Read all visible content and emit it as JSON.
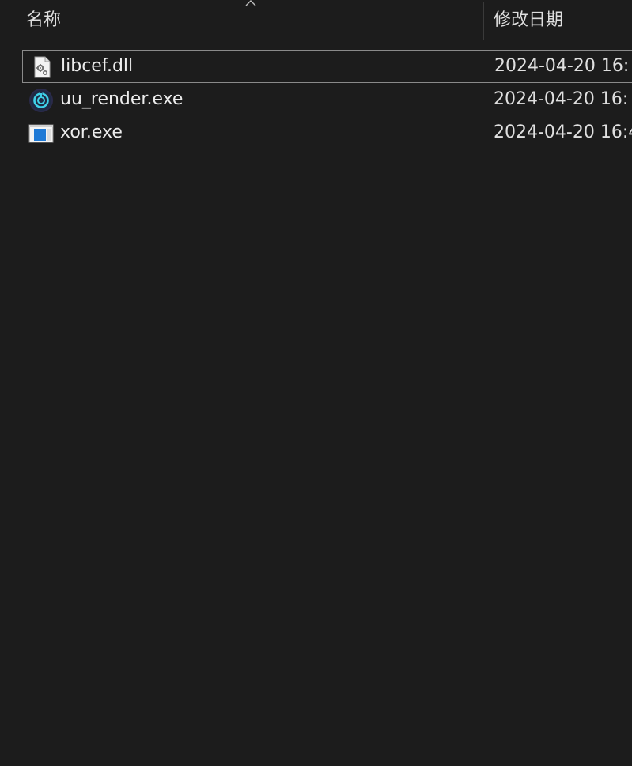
{
  "header": {
    "name_label": "名称",
    "date_label": "修改日期",
    "sort_icon": "chevron-up-icon"
  },
  "files": [
    {
      "name": "libcef.dll",
      "date": "2024-04-20 16:",
      "icon": "dll-settings-file-icon"
    },
    {
      "name": "uu_render.exe",
      "date": "2024-04-20 16:",
      "icon": "uu-app-icon"
    },
    {
      "name": "xor.exe",
      "date": "2024-04-20 16:4",
      "icon": "exe-window-icon"
    }
  ],
  "colors": {
    "background": "#1c1c1c",
    "text": "#ececec",
    "focus_border": "#8a8a8a"
  }
}
